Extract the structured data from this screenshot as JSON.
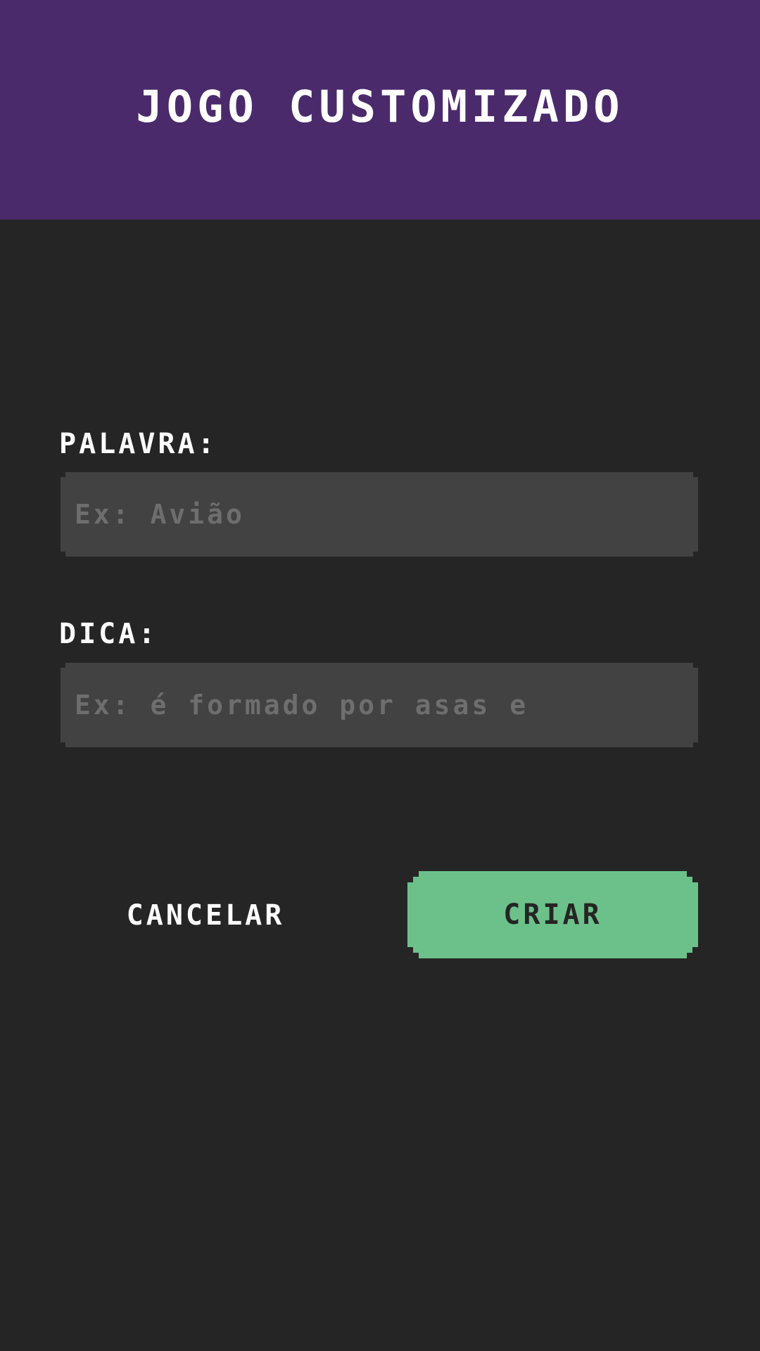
{
  "header": {
    "title": "JOGO CUSTOMIZADO"
  },
  "form": {
    "word": {
      "label": "PALAVRA:",
      "placeholder": "Ex: Avião",
      "value": ""
    },
    "hint": {
      "label": "DICA:",
      "placeholder": "Ex: é formado por asas e",
      "value": ""
    }
  },
  "actions": {
    "cancel_label": "CANCELAR",
    "create_label": "CRIAR"
  },
  "colors": {
    "header_bg": "#4a2a6b",
    "page_bg": "#252525",
    "input_bg": "#424242",
    "placeholder": "#6e6e6e",
    "accent_green": "#6cc18a",
    "text": "#ffffff"
  }
}
